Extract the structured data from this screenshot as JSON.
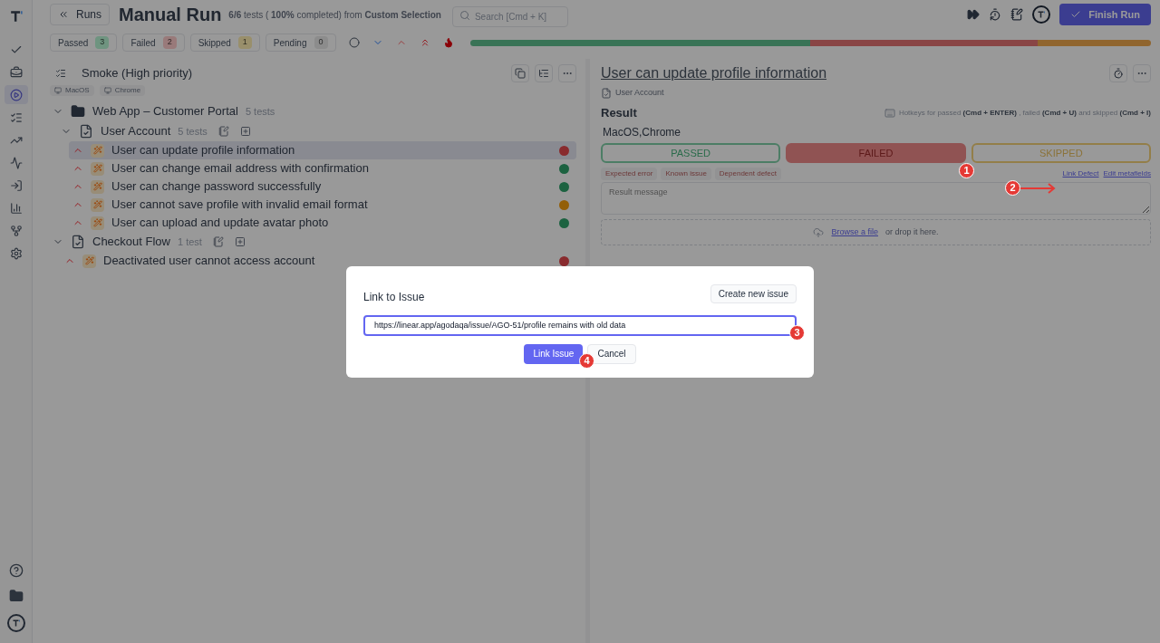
{
  "sidebar": {
    "items": [
      {
        "selected": false
      },
      {
        "selected": false
      },
      {
        "selected": true
      },
      {
        "selected": false
      },
      {
        "selected": false
      },
      {
        "selected": false
      },
      {
        "selected": false
      },
      {
        "selected": false
      },
      {
        "selected": false
      },
      {
        "selected": false
      }
    ]
  },
  "header": {
    "back": "Runs",
    "title": "Manual Run",
    "summary": "**6/6** tests ( **100%** completed) from **Custom Selection**",
    "search": {
      "placeholder": "Search [Cmd + K]"
    },
    "finish": "Finish Run"
  },
  "filters": [
    {
      "label": "Passed",
      "count": "3",
      "color": "#6f9480"
    },
    {
      "label": "Failed",
      "count": "2",
      "color": "#997a7a"
    },
    {
      "label": "Skipped",
      "count": "1",
      "color": "#998f6b"
    },
    {
      "label": "Pending",
      "count": "0",
      "color": "#8c8c8c"
    }
  ],
  "progress": [
    {
      "color": "#397356"
    },
    {
      "color": "#894545"
    },
    {
      "color": "#90652f"
    }
  ],
  "suite": {
    "title": "Smoke (High priority)",
    "tags": [
      "MacOS",
      "Chrome"
    ]
  },
  "tree": [
    {
      "kind": "folder",
      "name": "Web App – Customer Portal",
      "count": "5 tests",
      "expanded": true,
      "children": [
        {
          "kind": "suite",
          "name": "User Account",
          "count": "5 tests",
          "expanded": true,
          "children": [
            {
              "kind": "test",
              "name": "User can update profile information",
              "selected": true,
              "color": "#892b2e"
            },
            {
              "kind": "test",
              "name": "User can change email address with confirmation",
              "selected": false,
              "color": "#1d6241"
            },
            {
              "kind": "test",
              "name": "User can change password successfully",
              "selected": false,
              "color": "#1d6241"
            },
            {
              "kind": "test",
              "name": "User cannot save profile with invalid email format",
              "selected": false,
              "color": "#935f07"
            },
            {
              "kind": "test",
              "name": "User can upload and update avatar photo",
              "selected": false,
              "color": "#1d6241"
            }
          ]
        }
      ]
    },
    {
      "kind": "suite",
      "name": "Checkout Flow",
      "count": "1 test",
      "expanded": true,
      "children": [
        {
          "kind": "test",
          "name": "Deactivated user cannot access account",
          "selected": false,
          "color": "#892b2e"
        }
      ]
    }
  ],
  "detail": {
    "title": "User can update profile information",
    "breadcrumb": "User Account",
    "result_heading": "Result",
    "hotkeys": "Hotkeys for passed **(Cmd + ENTER)** , failed **(Cmd + U)** and skipped **(Cmd + I)**",
    "environment": "MacOS,Chrome",
    "statuses": [
      {
        "label": "PASSED",
        "kind": "passed",
        "selected": false
      },
      {
        "label": "FAILED",
        "kind": "failed",
        "selected": true
      },
      {
        "label": "SKIPPED",
        "kind": "skipped",
        "selected": false
      }
    ],
    "defect_tags": [
      "Expected error",
      "Known issue",
      "Dependent defect"
    ],
    "links": [
      "Link Defect",
      "Edit metafields"
    ],
    "message": {
      "placeholder": "Result message"
    },
    "upload": {
      "link": "Browse a file",
      "text": "or drop it here."
    }
  },
  "modal": {
    "title": "Link to Issue",
    "create": "Create new issue",
    "input": {
      "value": "https://linear.app/agodaqa/issue/AGO-51/profile remains with old data"
    },
    "confirm": "Link Issue",
    "cancel": "Cancel"
  },
  "annotations": [
    {
      "label": "1"
    },
    {
      "label": "2"
    },
    {
      "label": "3"
    },
    {
      "label": "4"
    }
  ]
}
